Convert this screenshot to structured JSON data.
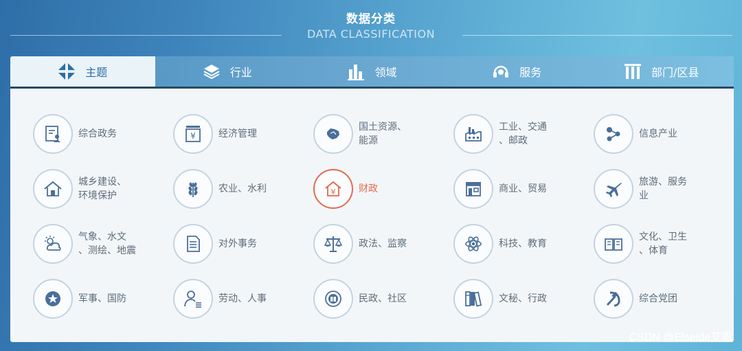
{
  "header": {
    "title_cn": "数据分类",
    "title_en": "DATA CLASSIFICATION"
  },
  "tabs": [
    {
      "label": "主题",
      "icon": "theme-icon",
      "active": true
    },
    {
      "label": "行业",
      "icon": "layers-icon",
      "active": false
    },
    {
      "label": "领域",
      "icon": "bar-chart-icon",
      "active": false
    },
    {
      "label": "服务",
      "icon": "headset-icon",
      "active": false
    },
    {
      "label": "部门/区县",
      "icon": "building-columns-icon",
      "active": false
    }
  ],
  "categories": [
    {
      "label_1": "综合政务",
      "label_2": "",
      "icon": "document-person-icon"
    },
    {
      "label_1": "经济管理",
      "label_2": "",
      "icon": "yen-cabinet-icon"
    },
    {
      "label_1": "国土资源、",
      "label_2": "能源",
      "icon": "map-china-icon"
    },
    {
      "label_1": "工业、交通",
      "label_2": "、邮政",
      "icon": "factory-icon"
    },
    {
      "label_1": "信息产业",
      "label_2": "",
      "icon": "network-nodes-icon"
    },
    {
      "label_1": "城乡建设、",
      "label_2": "环境保护",
      "icon": "house-icon"
    },
    {
      "label_1": "农业、水利",
      "label_2": "",
      "icon": "wheat-icon"
    },
    {
      "label_1": "财政",
      "label_2": "",
      "icon": "yen-house-icon",
      "active": true
    },
    {
      "label_1": "商业、贸易",
      "label_2": "",
      "icon": "storefront-icon"
    },
    {
      "label_1": "旅游、服务",
      "label_2": "业",
      "icon": "airplane-icon"
    },
    {
      "label_1": "气象、水文",
      "label_2": "、测绘、地震",
      "icon": "weather-sun-cloud-icon"
    },
    {
      "label_1": "对外事务",
      "label_2": "",
      "icon": "document-icon"
    },
    {
      "label_1": "政法、监察",
      "label_2": "",
      "icon": "scales-icon"
    },
    {
      "label_1": "科技、教育",
      "label_2": "",
      "icon": "atom-icon"
    },
    {
      "label_1": "文化、卫生",
      "label_2": "、体育",
      "icon": "open-book-icon"
    },
    {
      "label_1": "军事、国防",
      "label_2": "",
      "icon": "army-emblem-icon"
    },
    {
      "label_1": "劳动、人事",
      "label_2": "",
      "icon": "person-list-icon"
    },
    {
      "label_1": "民政、社区",
      "label_2": "",
      "icon": "emblem-icon"
    },
    {
      "label_1": "文秘、行政",
      "label_2": "",
      "icon": "binders-icon"
    },
    {
      "label_1": "综合党团",
      "label_2": "",
      "icon": "hammer-sickle-icon"
    }
  ],
  "watermark": "CSDN @Elseide艾思",
  "colors": {
    "accent_active": "#e26a4f",
    "tab_active_text": "#2b6fa6",
    "icon_blue": "#4a6f9a",
    "label_gray": "#5d6d7c"
  }
}
